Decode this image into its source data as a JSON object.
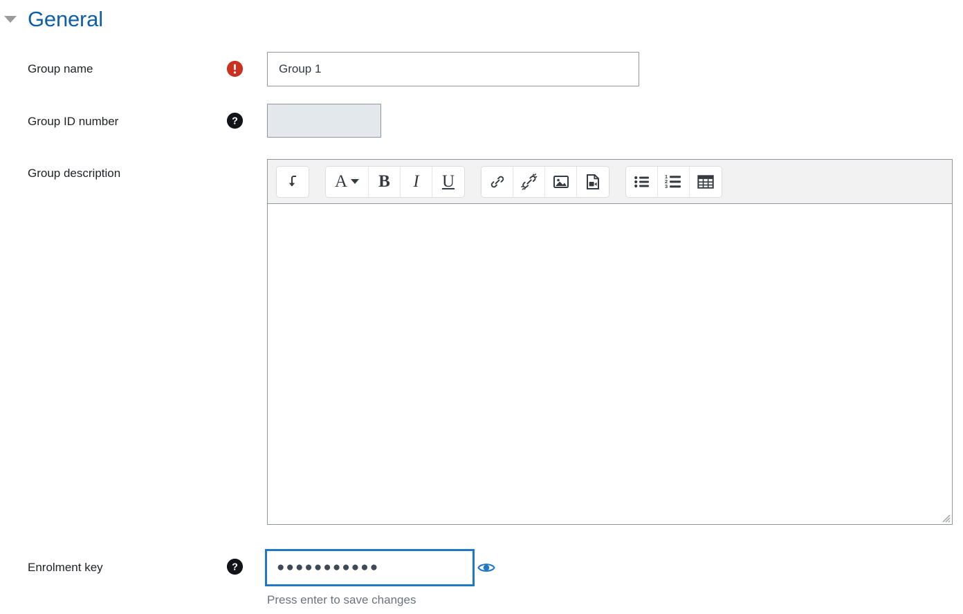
{
  "section": {
    "title": "General",
    "collapse_icon": "caret-down-icon",
    "expanded": true
  },
  "colors": {
    "heading": "#0f5fa8",
    "required_badge": "#ca3120",
    "help_badge": "#111418",
    "focus_border": "#1f78c1",
    "eye_icon": "#1f78c1",
    "input_border": "#8f959e",
    "disabled_bg": "#e3e8ed",
    "toolbar_bg": "#f2f2f2"
  },
  "fields": {
    "group_name": {
      "label": "Group name",
      "icon": "required-icon",
      "icon_title": "Required",
      "value": "Group 1",
      "placeholder": ""
    },
    "group_id_number": {
      "label": "Group ID number",
      "icon": "help-icon",
      "icon_title": "Help with Group ID number",
      "value": "",
      "placeholder": "",
      "disabled": true
    },
    "group_description": {
      "label": "Group description",
      "value": "",
      "placeholder": ""
    },
    "enrolment_key": {
      "label": "Enrolment key",
      "icon": "help-icon",
      "icon_title": "Help with Enrolment key",
      "value": "●●●●●●●●●●●",
      "masked_char_count": 11,
      "placeholder": "",
      "focused": true,
      "hint": "Press enter to save changes",
      "reveal_label": "Reveal",
      "reveal_icon": "eye-icon"
    }
  },
  "editor": {
    "toolbar_groups": [
      {
        "name": "expand-group",
        "buttons": [
          {
            "name": "expand-toolbar-button",
            "icon": "arrow-down-hook-icon",
            "title": "Show more buttons"
          }
        ]
      },
      {
        "name": "style-group",
        "buttons": [
          {
            "name": "font-style-button",
            "icon": "font-style-a-icon",
            "title": "Paragraph styles",
            "glyph": "A",
            "has_caret": true
          },
          {
            "name": "bold-button",
            "icon": "bold-icon",
            "title": "Bold",
            "glyph": "B"
          },
          {
            "name": "italic-button",
            "icon": "italic-icon",
            "title": "Italic",
            "glyph": "I"
          },
          {
            "name": "underline-button",
            "icon": "underline-icon",
            "title": "Underline",
            "glyph": "U"
          }
        ]
      },
      {
        "name": "insert-group",
        "buttons": [
          {
            "name": "link-button",
            "icon": "link-icon",
            "title": "Link"
          },
          {
            "name": "unlink-button",
            "icon": "unlink-icon",
            "title": "Unlink"
          },
          {
            "name": "image-button",
            "icon": "image-icon",
            "title": "Image"
          },
          {
            "name": "media-button",
            "icon": "media-icon",
            "title": "Multimedia"
          }
        ]
      },
      {
        "name": "list-group",
        "buttons": [
          {
            "name": "bullet-list-button",
            "icon": "bullet-list-icon",
            "title": "Unordered list"
          },
          {
            "name": "numbered-list-button",
            "icon": "numbered-list-icon",
            "title": "Ordered list"
          },
          {
            "name": "table-button",
            "icon": "table-icon",
            "title": "Table"
          }
        ]
      }
    ],
    "content": "",
    "resize_handle": "resize-grip-icon"
  }
}
